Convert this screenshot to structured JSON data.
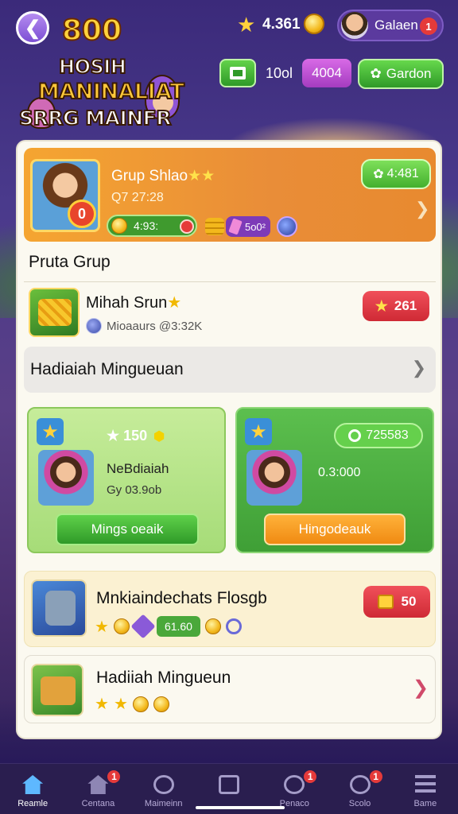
{
  "header": {
    "score": "800",
    "logo_lines": [
      "HOSIH",
      "MANINALIAT",
      "SRRG MAINFR"
    ],
    "star_count": "4.361",
    "profile_name": "Galaen",
    "profile_badge": "1",
    "top_text": "10ol",
    "purple_button": "4004",
    "green_button": "Gardon"
  },
  "featured": {
    "title": "Grup Shlao",
    "timer": "Q7 27:28",
    "coin_value": "4:93:",
    "purple_value": "5o0²",
    "reward": "4:481"
  },
  "section": {
    "title": "Pruta Grup"
  },
  "group": {
    "name": "Mihah Srun",
    "subtitle": "Mioaaurs @3:32K",
    "badge_value": "261"
  },
  "weekly": {
    "label": "Hadiaiah Mingueuan"
  },
  "cards": {
    "left": {
      "points": "★ 150",
      "name": "NeBdiaiah",
      "sub": "Gy 03.9ob",
      "button": "Mings oeaik"
    },
    "right": {
      "pill": "725583",
      "value": "0.3:000",
      "button": "Hingodeauk"
    }
  },
  "items": [
    {
      "name": "Mnkiaindechats Flosgb",
      "pill": "61.60",
      "button_value": "50"
    },
    {
      "name": "Hadiiah Mingueun"
    }
  ],
  "nav": [
    {
      "label": "Reamle",
      "icon": "home-icon",
      "badge": ""
    },
    {
      "label": "Centana",
      "icon": "house-icon",
      "badge": "1"
    },
    {
      "label": "Maimeinn",
      "icon": "clock-icon",
      "badge": ""
    },
    {
      "label": "",
      "icon": "bag-icon",
      "badge": ""
    },
    {
      "label": "Penaco",
      "icon": "medal-icon",
      "badge": "1"
    },
    {
      "label": "Scolo",
      "icon": "search-icon",
      "badge": "1"
    },
    {
      "label": "Bame",
      "icon": "menu-icon",
      "badge": ""
    }
  ],
  "colors": {
    "accent_orange": "#f5a531",
    "accent_green": "#3f9a2e",
    "badge_red": "#e53a3a",
    "nav_bg": "#2a1e4f"
  }
}
